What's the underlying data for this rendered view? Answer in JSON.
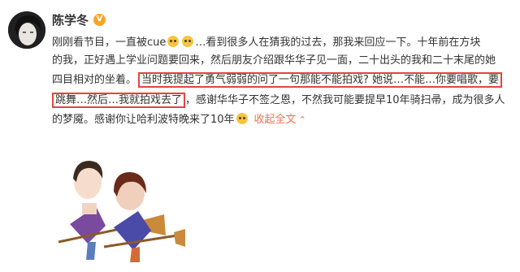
{
  "user": {
    "name": "陈学冬",
    "badge": "V"
  },
  "post": {
    "lines": [
      {
        "a": "刚刚看节目，一直被cue",
        "b": "…看到很多人在猜我的过去，那我来回应一下。十年前在方块"
      },
      {
        "a": "的我，正好遇上学业问题要回来，然后朋友介绍跟华华子见一面，二十出头的我和二十末尾的她"
      },
      {
        "a": "四目相对的坐着。",
        "hl": "当时我提起了勇气弱弱的问了一句那能不能拍戏? 她说…不能…你要唱歌，要"
      },
      {
        "hl": "跳舞…然后…我就拍戏去了",
        "a": "，感谢华华子不签之恩，不然我可能要提早10年骑扫帚，成为很多人"
      },
      {
        "a": "的梦魇。感谢你让哈利波特晚来了10年",
        "link": "收起全文"
      }
    ]
  },
  "colors": {
    "highlight": "#e0453f",
    "link": "#eb7350",
    "badge": "#f7a528"
  }
}
